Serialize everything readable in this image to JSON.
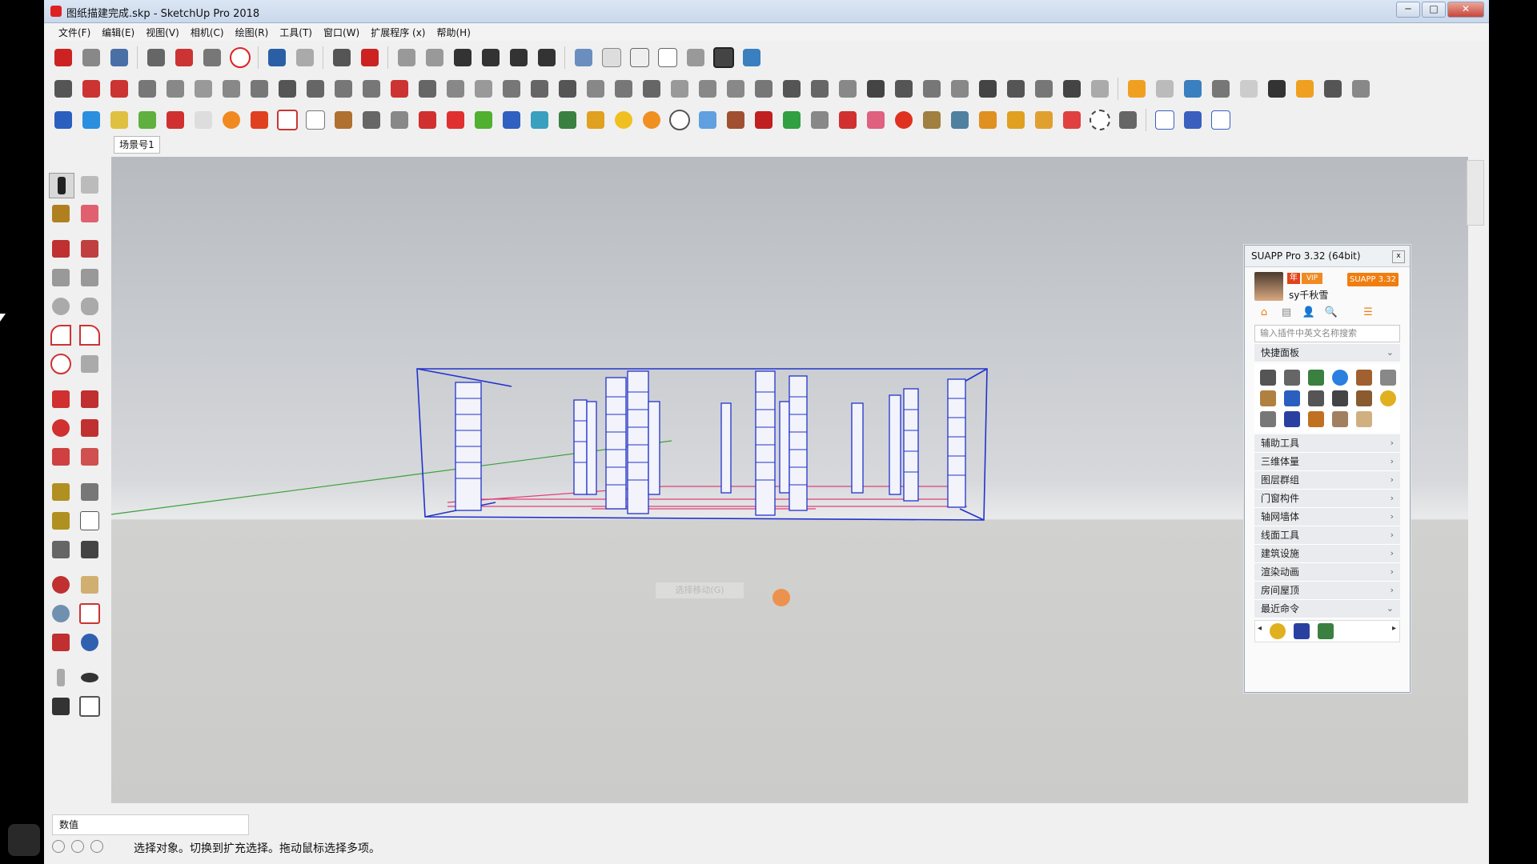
{
  "window": {
    "title": "图纸描建完成.skp - SketchUp Pro 2018",
    "minimize": "─",
    "maximize": "□",
    "close": "✕"
  },
  "menu": [
    "文件(F)",
    "编辑(E)",
    "视图(V)",
    "相机(C)",
    "绘图(R)",
    "工具(T)",
    "窗口(W)",
    "扩展程序 (x)",
    "帮助(H)"
  ],
  "scene_tab": "场景号1",
  "suapp": {
    "title": "SUAPP Pro 3.32 (64bit)",
    "close": "x",
    "badge_year": "年",
    "badge_vip": "VIP",
    "badge_version": "SUAPP 3.32",
    "username": "sy千秋雪",
    "tabs": [
      "⌂",
      "▤",
      "👤",
      "🔍",
      "☰"
    ],
    "search_placeholder": "输入插件中英文名称搜索",
    "quick_panel": "快捷面板",
    "categories": [
      "辅助工具",
      "三维体量",
      "图层群组",
      "门窗构件",
      "轴网墙体",
      "线面工具",
      "建筑设施",
      "渲染动画",
      "房间屋顶",
      "最近命令"
    ],
    "expand_arrow": "›",
    "collapse_arrow": "⌄",
    "left_arrow": "◂",
    "right_arrow": "▸"
  },
  "viewport": {
    "tooltip_ghost": "选择移动(G)"
  },
  "statusbar": {
    "measurements_label": "数值",
    "hint": "选择对象。切换到扩充选择。拖动鼠标选择多项。"
  },
  "colors": {
    "accent_orange": "#f07d0e",
    "selection_blue": "#2233cc",
    "magenta_lines": "#e0407a",
    "axis_green": "#3aa03a"
  }
}
